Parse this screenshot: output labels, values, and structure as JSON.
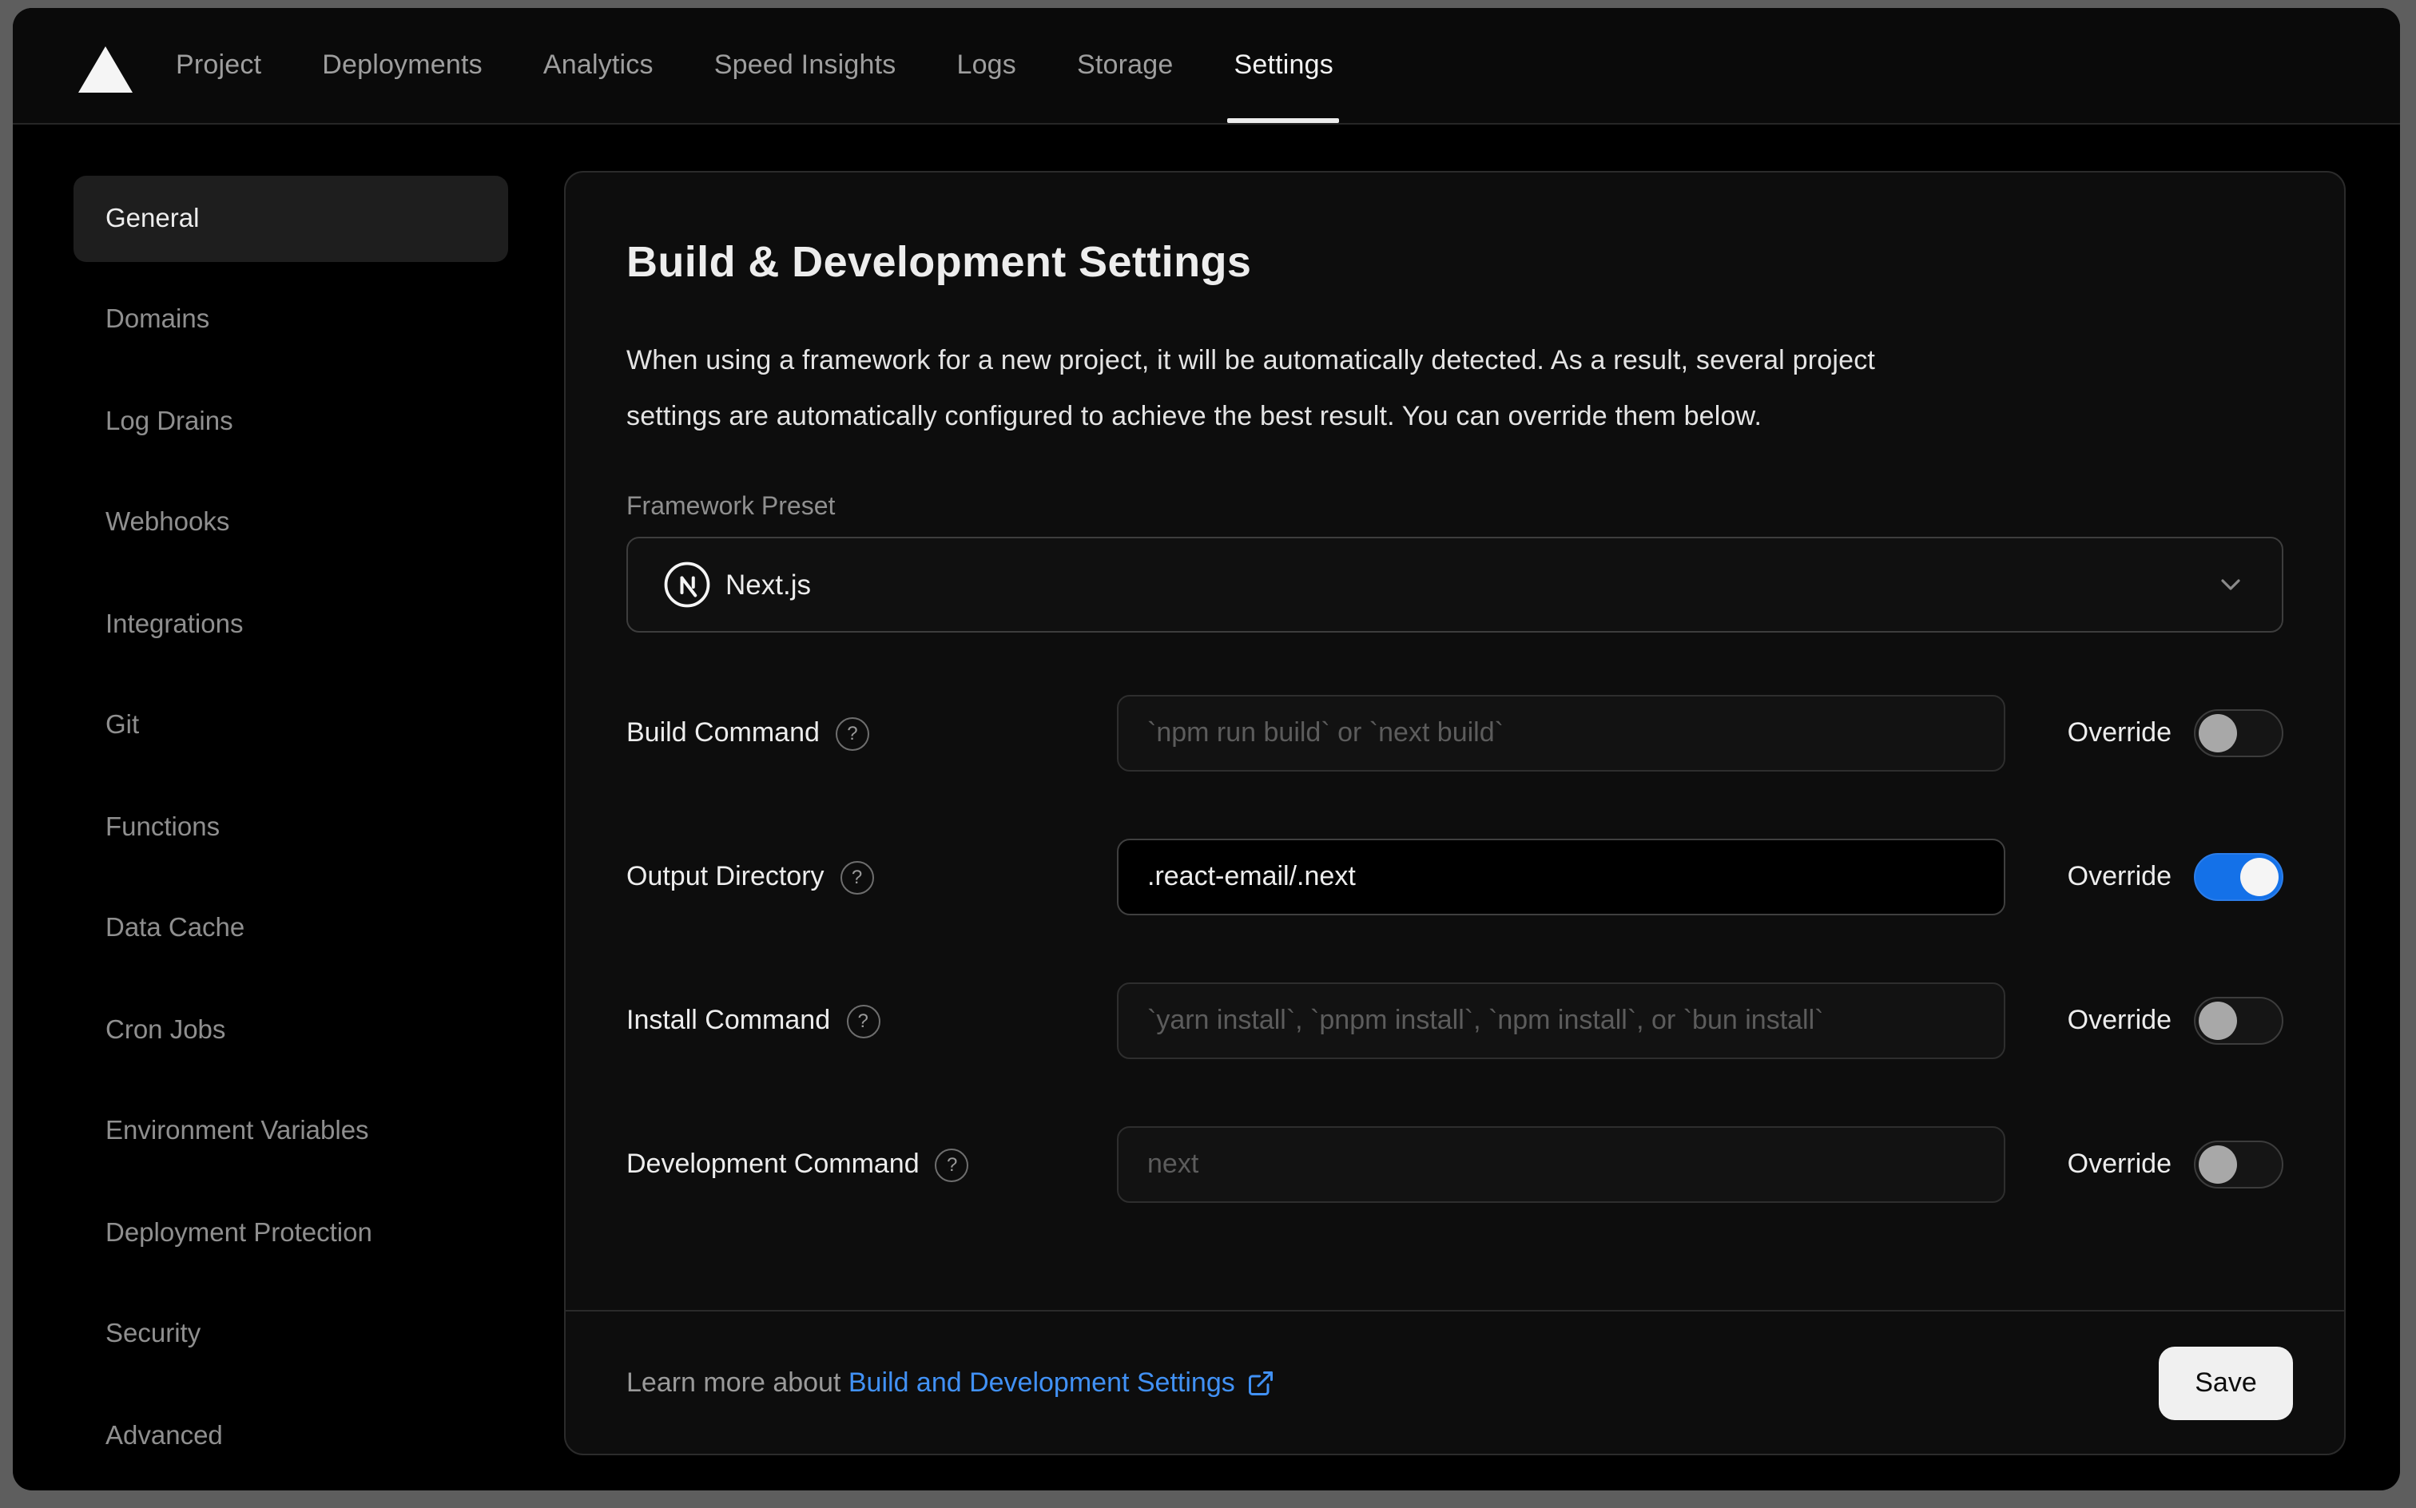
{
  "nav": {
    "logo_icon": "vercel-triangle-icon",
    "tabs": [
      {
        "label": "Project",
        "active": false
      },
      {
        "label": "Deployments",
        "active": false
      },
      {
        "label": "Analytics",
        "active": false
      },
      {
        "label": "Speed Insights",
        "active": false
      },
      {
        "label": "Logs",
        "active": false
      },
      {
        "label": "Storage",
        "active": false
      },
      {
        "label": "Settings",
        "active": true
      }
    ]
  },
  "sidebar": {
    "items": [
      {
        "label": "General",
        "active": true
      },
      {
        "label": "Domains",
        "active": false
      },
      {
        "label": "Log Drains",
        "active": false
      },
      {
        "label": "Webhooks",
        "active": false
      },
      {
        "label": "Integrations",
        "active": false
      },
      {
        "label": "Git",
        "active": false
      },
      {
        "label": "Functions",
        "active": false
      },
      {
        "label": "Data Cache",
        "active": false
      },
      {
        "label": "Cron Jobs",
        "active": false
      },
      {
        "label": "Environment Variables",
        "active": false
      },
      {
        "label": "Deployment Protection",
        "active": false
      },
      {
        "label": "Security",
        "active": false
      },
      {
        "label": "Advanced",
        "active": false
      }
    ]
  },
  "panel": {
    "title": "Build & Development Settings",
    "description_line1": "When using a framework for a new project, it will be automatically detected. As a result, several project",
    "description_line2": "settings are automatically configured to achieve the best result. You can override them below.",
    "framework_preset": {
      "label": "Framework Preset",
      "value": "Next.js",
      "icon": "nextjs-logo-icon",
      "chevron": "chevron-down-icon"
    },
    "override_label": "Override",
    "rows": [
      {
        "label": "Build Command",
        "placeholder": "`npm run build` or `next build`",
        "value": "",
        "override_on": false
      },
      {
        "label": "Output Directory",
        "placeholder": "",
        "value": ".react-email/.next",
        "override_on": true
      },
      {
        "label": "Install Command",
        "placeholder": "`yarn install`, `pnpm install`, `npm install`, or `bun install`",
        "value": "",
        "override_on": false
      },
      {
        "label": "Development Command",
        "placeholder": "next",
        "value": "",
        "override_on": false
      }
    ],
    "footer": {
      "learn_more_prefix": "Learn more about",
      "link_text": "Build and Development Settings",
      "link_icon": "external-link-icon",
      "save_label": "Save"
    }
  },
  "colors": {
    "frame": "#5e5e5e",
    "window_bg": "#000000",
    "nav_bg": "#0a0a0a",
    "card_bg": "#0d0d0d",
    "card_border": "#2b2b2b",
    "accent_toggle_on": "#1471e8",
    "link_blue": "#4191f5",
    "save_bg": "#f0f0f0",
    "text_primary": "#ededed",
    "text_muted": "#8f8f8f"
  }
}
